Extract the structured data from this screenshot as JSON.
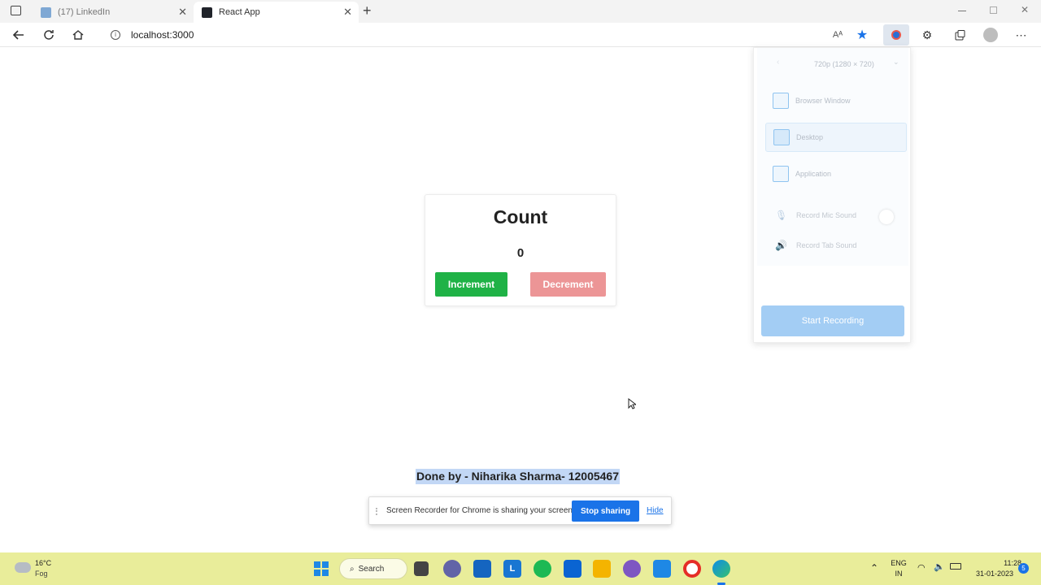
{
  "browser": {
    "tabs": [
      {
        "label": "(17) LinkedIn",
        "active": false,
        "favicon_color": "#0a66c2"
      },
      {
        "label": "React App",
        "active": true,
        "favicon_color": "#20232a"
      }
    ],
    "new_tab_glyph": "+",
    "url": "localhost:3000",
    "read_aloud_glyph": "Aᴬ"
  },
  "app": {
    "title": "Count",
    "count": "0",
    "increment_label": "Increment",
    "decrement_label": "Decrement",
    "credit": "Done by - Niharika Sharma- 12005467",
    "colors": {
      "increment": "#1fb246",
      "decrement": "#ec9596",
      "credit_highlight": "#c2d7f5"
    }
  },
  "recorder": {
    "resolution": "720p (1280 × 720)",
    "options": [
      "Browser Window",
      "Desktop",
      "Application"
    ],
    "selected": "Desktop",
    "mic_label": "Record Mic Sound",
    "tab_sound_label": "Record Tab Sound",
    "start_label": "Start Recording"
  },
  "sharing_bar": {
    "message": "Screen Recorder for Chrome is sharing your screen.",
    "stop_label": "Stop sharing",
    "hide_label": "Hide"
  },
  "taskbar": {
    "weather_temp": "16°C",
    "weather_desc": "Fog",
    "search_label": "Search",
    "lang_top": "ENG",
    "lang_bottom": "IN",
    "time": "11:28",
    "date": "31-01-2023",
    "notification_count": "5",
    "color": "#e9ed9a"
  }
}
